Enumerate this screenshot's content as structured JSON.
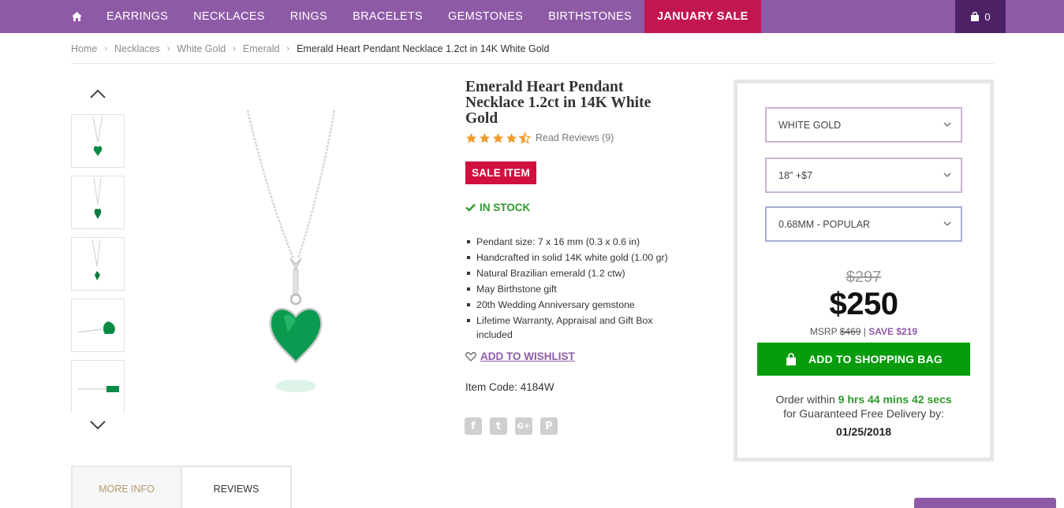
{
  "nav": {
    "items": [
      "EARRINGS",
      "NECKLACES",
      "RINGS",
      "BRACELETS",
      "GEMSTONES",
      "BIRTHSTONES"
    ],
    "sale": "JANUARY SALE",
    "cart_count": "0"
  },
  "breadcrumb": {
    "items": [
      "Home",
      "Necklaces",
      "White Gold",
      "Emerald"
    ],
    "current": "Emerald Heart Pendant Necklace 1.2ct in 14K White Gold"
  },
  "product": {
    "title": "Emerald Heart Pendant Necklace 1.2ct in 14K White Gold",
    "rating": 4.5,
    "reviews_label": "Read Reviews (9)",
    "sale_badge": "SALE ITEM",
    "stock": "IN STOCK",
    "features": [
      "Pendant size: 7 x 16 mm (0.3 x 0.6 in)",
      "Handcrafted in solid 14K white gold (1.00 gr)",
      "Natural Brazilian emerald (1.2 ctw)",
      "May Birthstone gift",
      "20th Wedding Anniversary gemstone",
      "Lifetime Warranty, Appraisal and Gift Box included"
    ],
    "wishlist": "ADD TO WISHLIST",
    "item_code": "Item Code: 4184W"
  },
  "buybox": {
    "metal": "WHITE GOLD",
    "length": "18\" +$7",
    "chain": "0.68MM - POPULAR",
    "old_price": "$297",
    "price": "$250",
    "msrp_label": "MSRP",
    "msrp_value": "$469",
    "divider": "|",
    "save": "SAVE $219",
    "add_to_bag": "ADD TO SHOPPING BAG",
    "order_within": "Order within",
    "order_time": "9 hrs 44 mins 42 secs",
    "order_suffix": "for Guaranteed Free Delivery by:",
    "delivery_date": "01/25/2018"
  },
  "tabs": {
    "more_info": "MORE INFO",
    "reviews": "REVIEWS"
  },
  "colors": {
    "brand_purple": "#8e5aa6",
    "sale_red": "#d1103f",
    "green": "#079c0c",
    "star": "#f39c2a"
  },
  "icons": [
    "home-icon",
    "shopping-bag-icon",
    "chevron-up-icon",
    "chevron-down-icon",
    "check-icon",
    "heart-icon",
    "facebook-icon",
    "twitter-icon",
    "google-plus-icon",
    "pinterest-icon",
    "lock-bag-icon"
  ]
}
